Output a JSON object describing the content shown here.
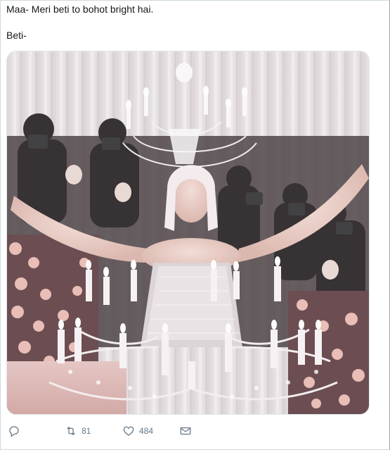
{
  "tweet": {
    "line1": "Maa- Meri beti to bohot bright hai.",
    "line2": "Beti-"
  },
  "actions": {
    "reply_icon": "reply-icon",
    "retweet_icon": "retweet-icon",
    "retweet_count": "81",
    "like_icon": "heart-icon",
    "like_count": "484",
    "share_icon": "share-envelope-icon"
  },
  "colors": {
    "text": "#14171a",
    "muted": "#657786",
    "border": "#cfd9de"
  }
}
